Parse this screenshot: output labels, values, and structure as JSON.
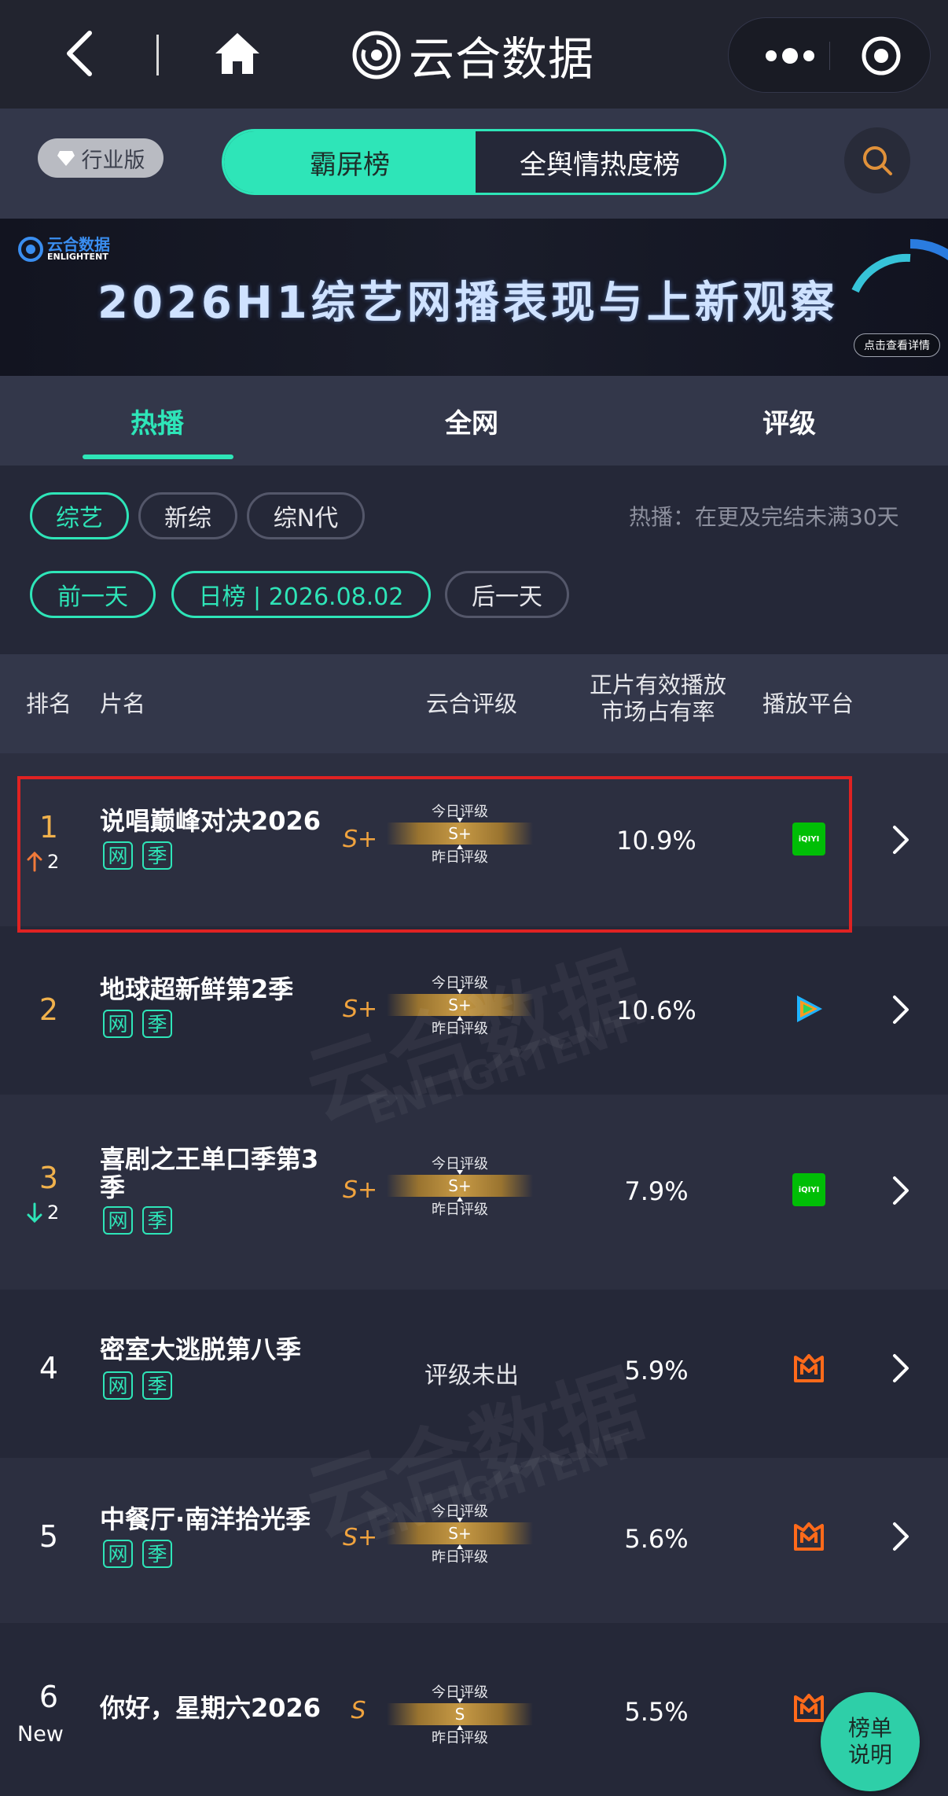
{
  "nav": {
    "brand": "云合数据"
  },
  "subbar": {
    "industry_label": "行业版",
    "segments": [
      "霸屏榜",
      "全舆情热度榜"
    ]
  },
  "banner": {
    "logo_cn": "云合数据",
    "logo_en": "ENLIGHTENT",
    "title": "2026H1综艺网播表现与上新观察",
    "detail_button": "点击查看详情"
  },
  "tabs": [
    "热播",
    "全网",
    "评级"
  ],
  "filters": {
    "categories": [
      "综艺",
      "新综",
      "综N代"
    ],
    "hint": "热播：在更及完结未满30天",
    "prev_day": "前一天",
    "date_label": "日榜 | 2026.08.02",
    "next_day": "后一天"
  },
  "table_header": {
    "rank": "排名",
    "title": "片名",
    "grade": "云合评级",
    "share_line1": "正片有效播放",
    "share_line2": "市场占有率",
    "platform": "播放平台"
  },
  "gauge_labels": {
    "today": "今日评级",
    "yesterday": "昨日评级"
  },
  "rows": [
    {
      "rank": "1",
      "move": "2",
      "move_dir": "up",
      "title": "说唱巅峰对决2026",
      "tags": [
        "网",
        "季"
      ],
      "grade": "S+",
      "gauge_grade": "S+",
      "share": "10.9%",
      "platform": "iqiyi-icon"
    },
    {
      "rank": "2",
      "move": "",
      "move_dir": "",
      "title": "地球超新鲜第2季",
      "tags": [
        "网",
        "季"
      ],
      "grade": "S+",
      "gauge_grade": "S+",
      "share": "10.6%",
      "platform": "tencent-video-icon"
    },
    {
      "rank": "3",
      "move": "2",
      "move_dir": "down",
      "title": "喜剧之王单口季第3季",
      "tags": [
        "网",
        "季"
      ],
      "grade": "S+",
      "gauge_grade": "S+",
      "share": "7.9%",
      "platform": "iqiyi-icon"
    },
    {
      "rank": "4",
      "move": "",
      "move_dir": "",
      "title": "密室大逃脱第八季",
      "tags": [
        "网",
        "季"
      ],
      "grade": "",
      "no_grade": "评级未出",
      "share": "5.9%",
      "platform": "mango-tv-icon"
    },
    {
      "rank": "5",
      "move": "",
      "move_dir": "",
      "title": "中餐厅·南洋拾光季",
      "tags": [
        "网",
        "季"
      ],
      "grade": "S+",
      "gauge_grade": "S+",
      "share": "5.6%",
      "platform": "mango-tv-icon"
    },
    {
      "rank": "6",
      "move": "New",
      "move_dir": "new",
      "title": "你好，星期六2026",
      "tags": [],
      "grade": "S",
      "gauge_grade": "S",
      "share": "5.5%",
      "platform": "mango-tv-icon"
    }
  ],
  "iqiyi_text": "iQIYI",
  "watermark": {
    "cn": "云合数据",
    "en": "ENLIGHTENT"
  },
  "fab": {
    "line1": "榜单",
    "line2": "说明"
  },
  "colors": {
    "accent": "#2ee5b8",
    "gold": "#f0a33e",
    "highlight": "#e02222",
    "bg": "#252838"
  }
}
